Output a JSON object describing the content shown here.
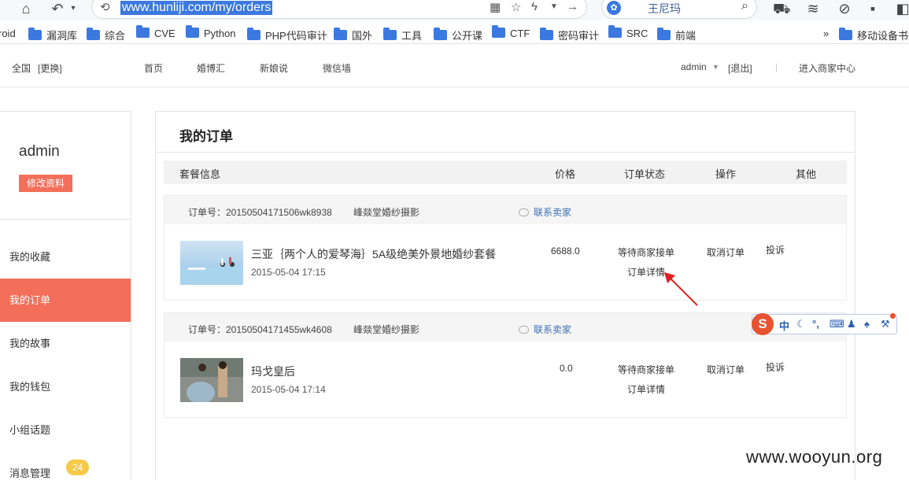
{
  "browser": {
    "url": "www.hunliji.com/my/orders",
    "search_query": "王尼玛",
    "bookmarks": [
      "roid",
      "漏洞库",
      "综合",
      "CVE",
      "Python",
      "PHP代码审计",
      "国外",
      "工具",
      "公开课",
      "CTF",
      "密码审计",
      "SRC",
      "前端"
    ],
    "more_label": "»",
    "mobile_bookmarks": "移动设备书签"
  },
  "header": {
    "region": "全国",
    "change": "[更换]",
    "nav": [
      "首页",
      "婚博汇",
      "新娘说",
      "微信墙"
    ],
    "user": "admin",
    "logout": "[退出]",
    "merchant": "进入商家中心"
  },
  "sidebar": {
    "username": "admin",
    "edit_label": "修改资料",
    "items": [
      "我的收藏",
      "我的订单",
      "我的故事",
      "我的钱包",
      "小组话题",
      "消息管理"
    ],
    "message_badge": "24"
  },
  "main": {
    "title": "我的订单",
    "columns": [
      "套餐信息",
      "价格",
      "订单状态",
      "操作",
      "其他"
    ],
    "orders": [
      {
        "order_no": "订单号：20150504171506wk8938",
        "shop": "峰燚堂婚纱摄影",
        "contact": "联系卖家",
        "product": "三亚｛两个人的爱琴海｝5A级绝美外景地婚纱套餐",
        "time": "2015-05-04 17:15",
        "price": "6688.0",
        "status": "等待商家接单",
        "detail": "订单详情",
        "cancel": "取消订单",
        "complain": "投诉"
      },
      {
        "order_no": "订单号：20150504171455wk4608",
        "shop": "峰燚堂婚纱摄影",
        "contact": "联系卖家",
        "product": "玛戈皇后",
        "time": "2015-05-04 17:14",
        "price": "0.0",
        "status": "等待商家接单",
        "detail": "订单详情",
        "cancel": "取消订单",
        "complain": "投诉"
      }
    ]
  },
  "ime": {
    "logo": "S",
    "mode": "中"
  },
  "watermark": "www.wooyun.org"
}
